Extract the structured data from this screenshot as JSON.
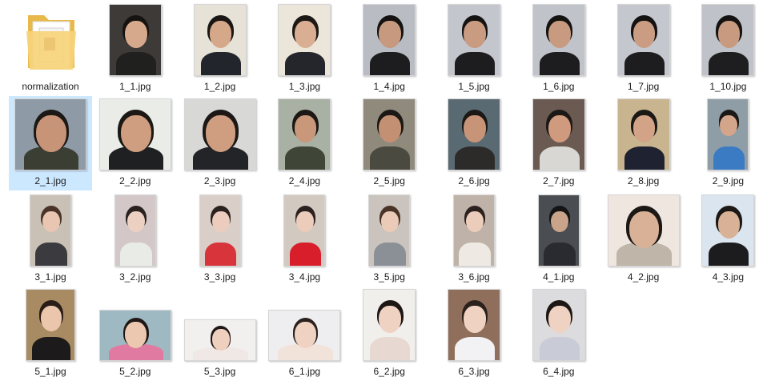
{
  "window": {
    "background": "#ffffff",
    "selection_color": "#cce8ff"
  },
  "files": [
    {
      "name": "normalization",
      "type": "folder",
      "icon": "folder-icon"
    },
    {
      "name": "1_1.jpg",
      "type": "image",
      "thumb": "portrait",
      "bg": "#3e3a38",
      "skin": "#d7a98c",
      "hair": "#161311",
      "cloth": "#20201f"
    },
    {
      "name": "1_2.jpg",
      "type": "image",
      "thumb": "portrait",
      "bg": "#e6e2d8",
      "skin": "#d6a88a",
      "hair": "#1a1614",
      "cloth": "#22252b"
    },
    {
      "name": "1_3.jpg",
      "type": "image",
      "thumb": "portrait",
      "bg": "#ece6da",
      "skin": "#d9ae92",
      "hair": "#1c1815",
      "cloth": "#24262c"
    },
    {
      "name": "1_4.jpg",
      "type": "image",
      "thumb": "portrait",
      "bg": "#b9bcc2",
      "skin": "#c79a80",
      "hair": "#151311",
      "cloth": "#1d1d1f"
    },
    {
      "name": "1_5.jpg",
      "type": "image",
      "thumb": "portrait",
      "bg": "#c3c6cc",
      "skin": "#c99c82",
      "hair": "#151311",
      "cloth": "#1d1d1f"
    },
    {
      "name": "1_6.jpg",
      "type": "image",
      "thumb": "portrait",
      "bg": "#c0c3c9",
      "skin": "#c89b81",
      "hair": "#151311",
      "cloth": "#1d1d1f"
    },
    {
      "name": "1_7.jpg",
      "type": "image",
      "thumb": "portrait",
      "bg": "#c4c7cd",
      "skin": "#ca9d83",
      "hair": "#151311",
      "cloth": "#1d1d1f"
    },
    {
      "name": "1_10.jpg",
      "type": "image",
      "thumb": "portrait",
      "bg": "#bfc2c8",
      "skin": "#c89a80",
      "hair": "#151311",
      "cloth": "#1e1e20"
    },
    {
      "name": "2_1.jpg",
      "type": "image",
      "thumb": "landscape",
      "bg": "#8e9aa5",
      "skin": "#c79478",
      "hair": "#1b1815",
      "cloth": "#3a3e33",
      "selected": true
    },
    {
      "name": "2_2.jpg",
      "type": "image",
      "thumb": "landscape",
      "bg": "#e9ece7",
      "skin": "#cf9e81",
      "hair": "#1b1815",
      "cloth": "#1f2022"
    },
    {
      "name": "2_3.jpg",
      "type": "image",
      "thumb": "landscape",
      "bg": "#d8d9d7",
      "skin": "#cf9e81",
      "hair": "#1b1815",
      "cloth": "#222428"
    },
    {
      "name": "2_4.jpg",
      "type": "image",
      "thumb": "portrait",
      "bg": "#a9b0a4",
      "skin": "#c9977a",
      "hair": "#1b1815",
      "cloth": "#3f4638"
    },
    {
      "name": "2_5.jpg",
      "type": "image",
      "thumb": "portrait",
      "bg": "#8f8a7c",
      "skin": "#c49073",
      "hair": "#1b1815",
      "cloth": "#4a4a40"
    },
    {
      "name": "2_6.jpg",
      "type": "image",
      "thumb": "portrait",
      "bg": "#5a6a72",
      "skin": "#c79478",
      "hair": "#1b1815",
      "cloth": "#2d2b2a"
    },
    {
      "name": "2_7.jpg",
      "type": "image",
      "thumb": "portrait",
      "bg": "#6b5a52",
      "skin": "#cf9a7e",
      "hair": "#1b1815",
      "cloth": "#d9d7d3"
    },
    {
      "name": "2_8.jpg",
      "type": "image",
      "thumb": "portrait",
      "bg": "#c8b58f",
      "skin": "#d2a386",
      "hair": "#1b1815",
      "cloth": "#1f2230"
    },
    {
      "name": "2_9.jpg",
      "type": "image",
      "thumb": "portrait",
      "bg": "#8f9ea6",
      "skin": "#d3a68b",
      "hair": "#1b1815",
      "cloth": "#3b7bc4"
    },
    {
      "name": "3_1.jpg",
      "type": "image",
      "thumb": "portrait",
      "bg": "#c9c0b6",
      "skin": "#e8c6b2",
      "hair": "#4a3428",
      "cloth": "#3b3b3f"
    },
    {
      "name": "3_2.jpg",
      "type": "image",
      "thumb": "portrait",
      "bg": "#d3c7c8",
      "skin": "#ecd1c3",
      "hair": "#2b2220",
      "cloth": "#e9ece6"
    },
    {
      "name": "3_3.jpg",
      "type": "image",
      "thumb": "portrait",
      "bg": "#d9cfc8",
      "skin": "#eccdbd",
      "hair": "#2b2220",
      "cloth": "#d8343c"
    },
    {
      "name": "3_4.jpg",
      "type": "image",
      "thumb": "portrait",
      "bg": "#d2c9c1",
      "skin": "#ecccba",
      "hair": "#2b2220",
      "cloth": "#d81e2a"
    },
    {
      "name": "3_5.jpg",
      "type": "image",
      "thumb": "portrait",
      "bg": "#cbc3bd",
      "skin": "#ebcbb8",
      "hair": "#4a3428",
      "cloth": "#8b8f96"
    },
    {
      "name": "3_6.jpg",
      "type": "image",
      "thumb": "portrait",
      "bg": "#bfb2a8",
      "skin": "#ecccba",
      "hair": "#2b2220",
      "cloth": "#efe9e4"
    },
    {
      "name": "4_1.jpg",
      "type": "image",
      "thumb": "portrait",
      "bg": "#4a4d52",
      "skin": "#c9a48a",
      "hair": "#141414",
      "cloth": "#2a2b30"
    },
    {
      "name": "4_2.jpg",
      "type": "image",
      "thumb": "landscape",
      "bg": "#efe6df",
      "skin": "#d8b197",
      "hair": "#1b1815",
      "cloth": "#bfb6a9"
    },
    {
      "name": "4_3.jpg",
      "type": "image",
      "thumb": "portrait",
      "bg": "#dbe5ef",
      "skin": "#d8b197",
      "hair": "#1b1815",
      "cloth": "#1c1c1e"
    },
    {
      "name": "5_1.jpg",
      "type": "image",
      "thumb": "portrait",
      "bg": "#a88b62",
      "skin": "#ebc6ad",
      "hair": "#2a1c16",
      "cloth": "#1c1a1a"
    },
    {
      "name": "5_2.jpg",
      "type": "image",
      "thumb": "landscape",
      "bg": "#9fb9c2",
      "skin": "#ecc8b1",
      "hair": "#1f1816",
      "cloth": "#e07aa0"
    },
    {
      "name": "5_3.jpg",
      "type": "image",
      "thumb": "landscape",
      "bg": "#f2f0ef",
      "skin": "#efd0bf",
      "hair": "#1f1816",
      "cloth": "#f0e8e4"
    },
    {
      "name": "6_1.jpg",
      "type": "image",
      "thumb": "landscape",
      "bg": "#eeeef0",
      "skin": "#efd2c2",
      "hair": "#2a201c",
      "cloth": "#f1e2da"
    },
    {
      "name": "6_2.jpg",
      "type": "image",
      "thumb": "portrait",
      "bg": "#f1efec",
      "skin": "#efd2c2",
      "hair": "#1c1614",
      "cloth": "#e8d8d2"
    },
    {
      "name": "6_3.jpg",
      "type": "image",
      "thumb": "portrait",
      "bg": "#8f6f5c",
      "skin": "#efd2c2",
      "hair": "#2a201c",
      "cloth": "#f2f2f4"
    },
    {
      "name": "6_4.jpg",
      "type": "image",
      "thumb": "portrait",
      "bg": "#dcdcde",
      "skin": "#efd2c2",
      "hair": "#1c1614",
      "cloth": "#c9ccd6"
    }
  ]
}
